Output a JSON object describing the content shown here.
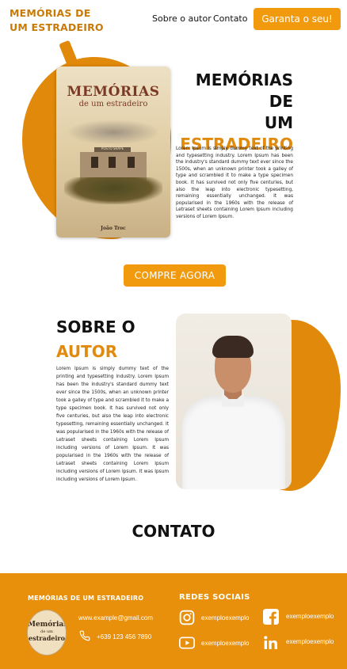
{
  "header": {
    "logo_line1": "MEMÓRIAS DE",
    "logo_line2": "UM ESTRADEIRO",
    "nav": {
      "about": "Sobre o autor",
      "contact": "Contato"
    },
    "cta": "Garanta o seu!"
  },
  "hero": {
    "title_line1": "MEMÓRIAS DE",
    "title_line2": "UM",
    "title_line3": "ESTRADEIRO",
    "body": "Lorem Ipsum is simply dummy text of the printing and typesetting industry. Lorem Ipsum has been the industry's standard dummy text ever since the 1500s, when an unknown printer took a galley of type and scrambled it to make a type specimen book. It has survived not only five centuries, but also the leap into electronic typesetting, remaining essentially unchanged. It was popularised in the 1960s with the release of Letraset sheets containing Lorem Ipsum including versions of Lorem Ipsum.",
    "book": {
      "title": "MEMÓRIAS",
      "subtitle": "de um estradeiro",
      "sign": "POSTO SHAPE",
      "author": "João Troc"
    },
    "buy_button": "COMPRE AGORA"
  },
  "about": {
    "title_line1": "SOBRE O",
    "title_line2": "AUTOR",
    "body": "Lorem Ipsum is simply dummy text of the printing and typesetting industry. Lorem Ipsum has been the industry's standard dummy text ever since the 1500s, when an unknown printer took a galley of type and scrambled it to make a type specimen book. It has survived not only five centuries, but also the leap into electronic typesetting, remaining essentially unchanged. It was popularised in the 1960s with the release of Letraset sheets containing Lorem Ipsum including versions of Lorem Ipsum. It was popularised in the 1960s with the release of Letraset sheets containing Lorem Ipsum including versions of Lorem Ipsum. It was Ipsum including versions of Lorem Ipsum."
  },
  "contact": {
    "title": "CONTATO"
  },
  "footer": {
    "brand": "MEMÓRIAS DE UM ESTRADEIRO",
    "logo_line1": "Memórias",
    "logo_line2": "de um",
    "logo_line3": "estradeiro",
    "email": "www.example@gmail.com",
    "phone": "+639 123 456 7890",
    "social_title": "REDES SOCIAIS",
    "instagram": "exemploexemplo",
    "facebook": "exemploexemplo",
    "youtube": "exemploexemplo",
    "linkedin": "exemploexemplo"
  },
  "colors": {
    "accent": "#f29a0e",
    "accent_dark": "#e0890a",
    "logo_text": "#c97a06",
    "footer_bg": "#e8900c"
  },
  "icons": [
    "phone-icon",
    "instagram-icon",
    "facebook-icon",
    "youtube-icon",
    "linkedin-icon"
  ]
}
